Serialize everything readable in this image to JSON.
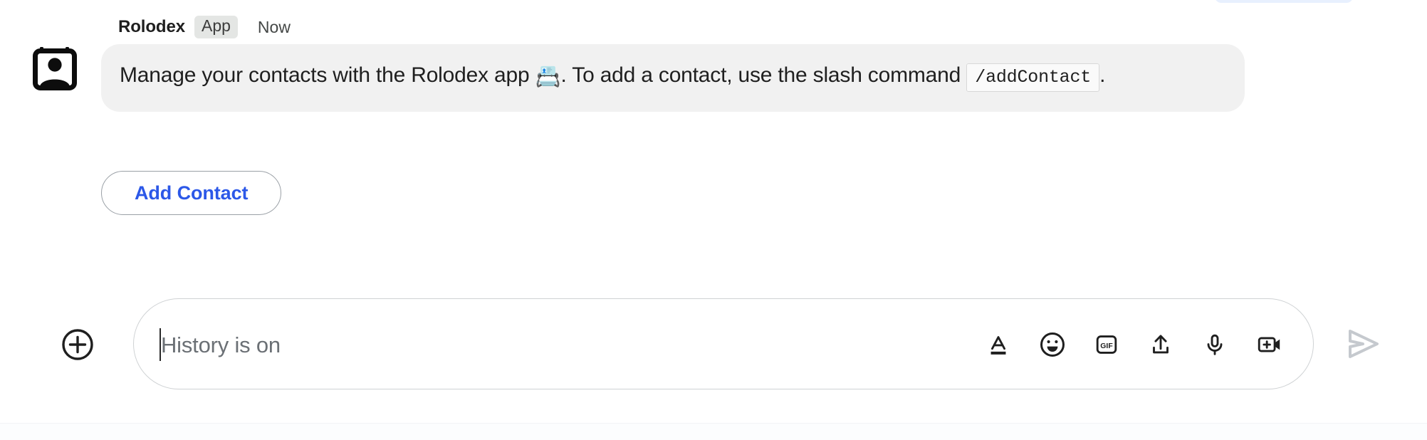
{
  "top_chip": {
    "name": "clipped-pill",
    "color": "#e8f0fe"
  },
  "message": {
    "sender": "Rolodex",
    "badge": "App",
    "timestamp": "Now",
    "avatar_icon": "contact-card-icon",
    "text_before_emoji": "Manage your contacts with the Rolodex app ",
    "emoji": "📇",
    "text_after_emoji": ". To add a contact, use the slash command ",
    "code": "/addContact",
    "text_end": ".",
    "bubble_color": "#f1f1f1"
  },
  "actions": {
    "add_contact_label": "Add Contact",
    "accent_color": "#2c58e8"
  },
  "composer": {
    "placeholder": "History is on",
    "value": "",
    "plus_icon": "plus-circle-icon",
    "tools": [
      {
        "name": "format-text-icon",
        "label": "A"
      },
      {
        "name": "emoji-icon",
        "label": "smiley"
      },
      {
        "name": "gif-icon",
        "label": "GIF"
      },
      {
        "name": "upload-icon",
        "label": "upload"
      },
      {
        "name": "microphone-icon",
        "label": "mic"
      },
      {
        "name": "add-video-icon",
        "label": "video"
      }
    ],
    "send_icon": "send-arrow-icon",
    "send_disabled_color": "#c5c9ce"
  }
}
